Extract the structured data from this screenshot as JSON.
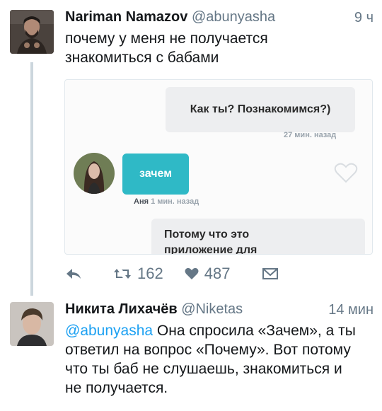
{
  "tweet1": {
    "author_name": "Nariman Namazov",
    "author_handle": "@abunyasha",
    "time": "9 ч",
    "text_line1": "почему у меня не получается",
    "text_line2": "знакомиться с бабами",
    "attached_image": {
      "message_top": "Как ты? Познакомимся?)",
      "message_top_time": "27 мин. назад",
      "reply_text": "зачем",
      "reply_sender": "Аня",
      "reply_time": "1 мин. назад",
      "message_bottom_line1": "Потому что это",
      "message_bottom_line2": "приложение для"
    },
    "actions": {
      "retweet_count": "162",
      "like_count": "487"
    }
  },
  "tweet2": {
    "author_name": "Никита Лихачёв",
    "author_handle": "@Niketas",
    "time": "14 мин",
    "mention": "@abunyasha",
    "text_line1_rest": " Она спросила «Зачем», а ты",
    "text_line2": "ответил на вопрос «Почему». Вот потому",
    "text_line3": "что ты баб не слушаешь, знакомиться и",
    "text_line4": "не получается."
  },
  "colors": {
    "link": "#1da1f2",
    "secondary_text": "#657786",
    "reply_bubble": "#2fb9c6"
  }
}
